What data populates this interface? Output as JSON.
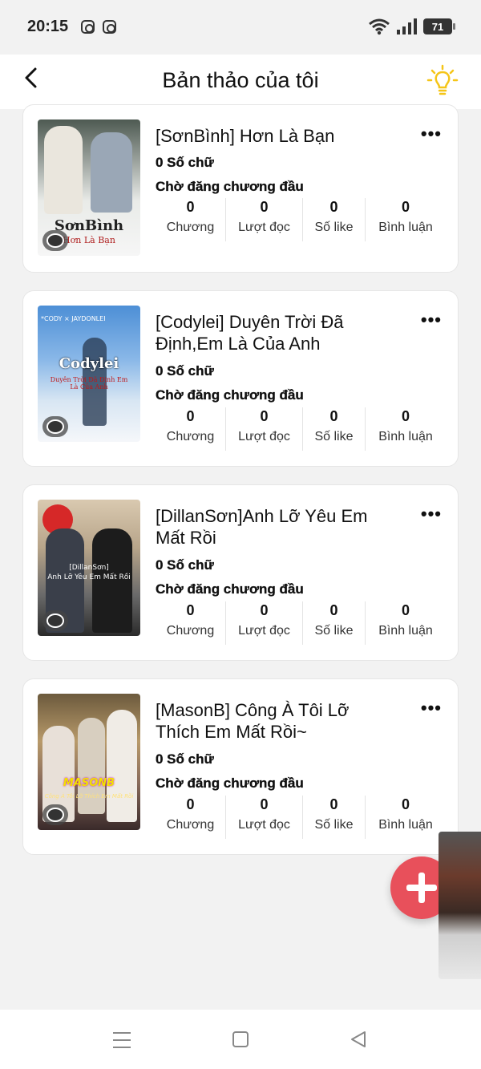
{
  "status_bar": {
    "time": "20:15",
    "battery": "71"
  },
  "header": {
    "title": "Bản thảo của tôi"
  },
  "stat_labels": {
    "chapters": "Chương",
    "reads": "Lượt đọc",
    "likes": "Số like",
    "comments": "Bình luận"
  },
  "stories": [
    {
      "title": "[SơnBình] Hơn Là Bạn",
      "word_count": "0 Số chữ",
      "status": "Chờ đăng chương đầu",
      "chapters": "0",
      "reads": "0",
      "likes": "0",
      "comments": "0",
      "cover_line1": "SơnBình",
      "cover_line2": "Hơn Là Bạn"
    },
    {
      "title": "[Codylei] Duyên Trời Đã Định,Em Là Của Anh",
      "word_count": "0 Số chữ",
      "status": "Chờ đăng chương đầu",
      "chapters": "0",
      "reads": "0",
      "likes": "0",
      "comments": "0",
      "cover_top": "*CODY × JAYDONLEI",
      "cover_line1": "Codylei",
      "cover_line2": "Duyên Trời Đã Định Em Là Của Anh"
    },
    {
      "title": "[DillanSơn]Anh Lỡ Yêu Em Mất Rồi",
      "word_count": "0 Số chữ",
      "status": "Chờ đăng chương đầu",
      "chapters": "0",
      "reads": "0",
      "likes": "0",
      "comments": "0",
      "cover_line1": "[DillanSơn]",
      "cover_line2": "Anh Lỡ Yêu Em Mất Rồi"
    },
    {
      "title": "[MasonB] Công À Tôi Lỡ Thích Em Mất Rồi~",
      "word_count": "0 Số chữ",
      "status": "Chờ đăng chương đầu",
      "chapters": "0",
      "reads": "0",
      "likes": "0",
      "comments": "0",
      "cover_line1": "MASONB",
      "cover_line2": "Công À Tôi Lỡ Thích Em Mất Rồi"
    }
  ],
  "colors": {
    "accent": "#e8505b",
    "bulb": "#f5c518",
    "background": "#f2f2f2"
  },
  "icons": {
    "back": "chevron-left-icon",
    "bulb": "lightbulb-icon",
    "more": "more-horizontal-icon",
    "comment": "comment-bubble-icon",
    "add": "plus-icon"
  }
}
